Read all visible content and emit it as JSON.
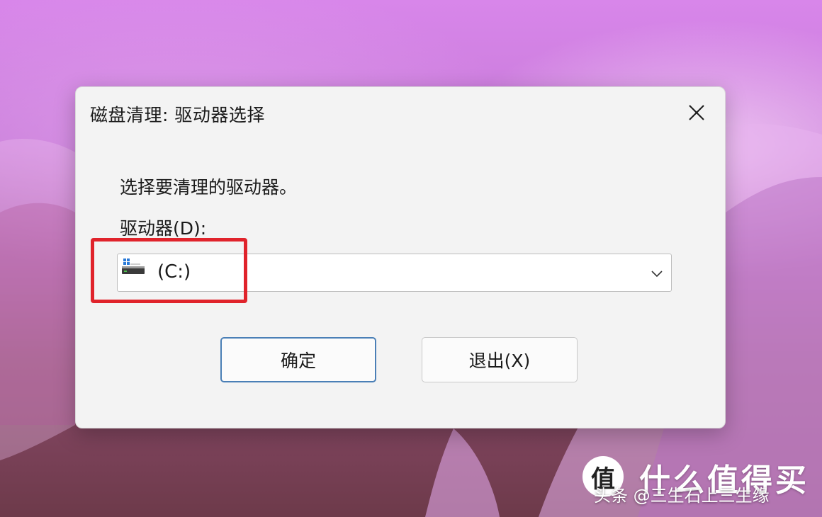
{
  "dialog": {
    "title": "磁盘清理: 驱动器选择",
    "close_icon": "close-icon",
    "instruction": "选择要清理的驱动器。",
    "drive_label": "驱动器(D):",
    "drive_select": {
      "value": "(C:)",
      "icon": "windows-drive-icon",
      "dropdown_icon": "chevron-down-icon"
    },
    "ok_button": "确定",
    "exit_button": "退出(X)"
  },
  "annotation": {
    "highlight_color": "#e0232b"
  },
  "watermark": {
    "logo_text": "值",
    "brand": "什么值得买",
    "sub": "头条 @三生石上三生缘"
  },
  "colors": {
    "dialog_bg": "#f3f3f3",
    "accent_border": "#4a7fb6"
  }
}
